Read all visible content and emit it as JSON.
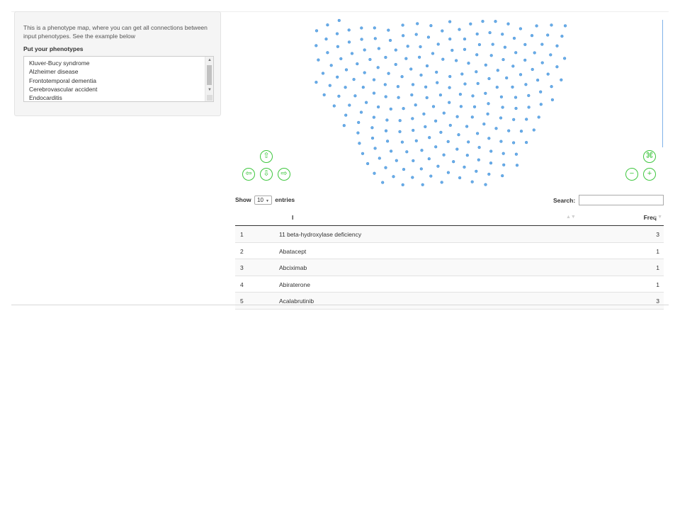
{
  "sidebar": {
    "intro": "This is a phenotype map, where you can get all connections between input phenotypes. See the example below",
    "label": "Put your phenotypes",
    "phenotypes": [
      "Kluver-Bucy syndrome",
      "Alzheimer disease",
      "Frontotemporal dementia",
      "Cerebrovascular accident",
      "Endocarditis"
    ]
  },
  "network": {
    "node_color": "#6aaee8",
    "button_color": "#3ec63e",
    "buttons": {
      "up": "⇧",
      "left": "⇦",
      "down": "⇩",
      "right": "⇨",
      "fit": "⌘",
      "zoom_out": "−",
      "zoom_in": "+"
    }
  },
  "table": {
    "show_label": "Show",
    "page_length": "10",
    "entries_label": "entries",
    "search_label": "Search:",
    "columns": [
      "I",
      "Freq"
    ],
    "rows": [
      {
        "idx": "1",
        "name": "11 beta-hydroxylase deficiency",
        "freq": "3"
      },
      {
        "idx": "2",
        "name": "Abatacept",
        "freq": "1"
      },
      {
        "idx": "3",
        "name": "Abciximab",
        "freq": "1"
      },
      {
        "idx": "4",
        "name": "Abiraterone",
        "freq": "1"
      },
      {
        "idx": "5",
        "name": "Acalabrutinib",
        "freq": "3"
      }
    ]
  }
}
